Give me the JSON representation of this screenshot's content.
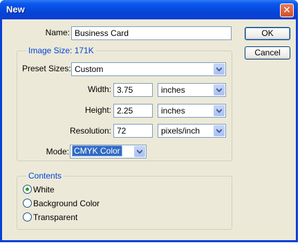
{
  "window": {
    "title": "New",
    "close_glyph": "✕"
  },
  "name": {
    "label": "Name:",
    "value": "Business Card"
  },
  "image_size": {
    "legend": "Image Size: 171K"
  },
  "preset": {
    "label": "Preset Sizes:",
    "value": "Custom"
  },
  "width": {
    "label": "Width:",
    "value": "3.75",
    "unit": "inches"
  },
  "height": {
    "label": "Height:",
    "value": "2.25",
    "unit": "inches"
  },
  "resolution": {
    "label": "Resolution:",
    "value": "72",
    "unit": "pixels/inch"
  },
  "mode": {
    "label": "Mode:",
    "value": "CMYK Color"
  },
  "contents": {
    "legend": "Contents",
    "options": [
      {
        "label": "White",
        "selected": true
      },
      {
        "label": "Background Color",
        "selected": false
      },
      {
        "label": "Transparent",
        "selected": false
      }
    ]
  },
  "buttons": {
    "ok": "OK",
    "cancel": "Cancel"
  },
  "colors": {
    "title_bar": "#0545d8",
    "dialog_bg": "#ece9d8",
    "legend_text": "#0046d5",
    "selection": "#316ac5",
    "radio_dot": "#21a121"
  }
}
